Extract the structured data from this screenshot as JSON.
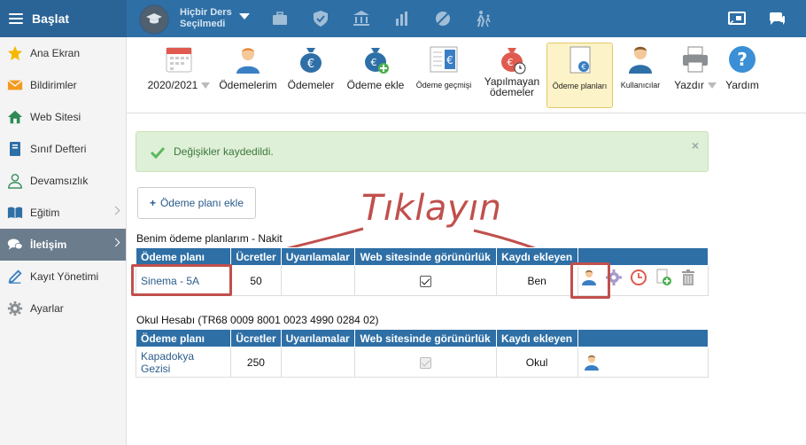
{
  "topbar": {
    "brand": "Başlat",
    "course_line1": "Hiçbir Ders",
    "course_line2": "Seçilmedi",
    "icons": [
      "briefcase-icon",
      "shield-icon",
      "bank-icon",
      "bar-chart-icon",
      "no-phone-icon",
      "walking-kids-icon",
      "cast-icon",
      "chat-icon"
    ]
  },
  "sidebar": {
    "items": [
      {
        "label": "Ana Ekran",
        "icon": "star-icon"
      },
      {
        "label": "Bildirimler",
        "icon": "envelope-icon"
      },
      {
        "label": "Web Sitesi",
        "icon": "home-icon"
      },
      {
        "label": "Sınıf Defteri",
        "icon": "notebook-icon"
      },
      {
        "label": "Devamsızlık",
        "icon": "person-outline-icon"
      },
      {
        "label": "Eğitim",
        "icon": "book-icon"
      },
      {
        "label": "İletişim",
        "icon": "chat-bubbles-icon"
      },
      {
        "label": "Kayıt Yönetimi",
        "icon": "pencil-icon"
      },
      {
        "label": "Ayarlar",
        "icon": "gear-icon"
      }
    ]
  },
  "toolbar": {
    "year": "2020/2021",
    "odemelerim": "Ödemelerim",
    "odemeler": "Ödemeler",
    "odeme_ekle": "Ödeme ekle",
    "odeme_gecmisi": "Ödeme geçmişi",
    "yapilmayan_1": "Yapılmayan",
    "yapilmayan_2": "ödemeler",
    "odeme_planlari": "Ödeme planları",
    "kullanicilar": "Kullanıcılar",
    "yazdir": "Yazdır",
    "yardim": "Yardım"
  },
  "alert": {
    "message": "Değişikler kaydedildi.",
    "close": "×"
  },
  "add_plan_button": "Ödeme planı ekle",
  "annotation": "Tıklayın",
  "section1": {
    "title": "Benim ödeme planlarım - Nakit",
    "headers": [
      "Ödeme planı",
      "Ücretler",
      "Uyarılamalar",
      "Web sitesinde görünürlük",
      "Kaydı ekleyen"
    ],
    "row": {
      "name": "Sinema - 5A",
      "fee": "50",
      "warnings": "",
      "visible": true,
      "added_by": "Ben"
    }
  },
  "section2": {
    "title": "Okul Hesabı (TR68 0009 8001 0023 4990 0284 02)",
    "headers": [
      "Ödeme planı",
      "Ücretler",
      "Uyarılamalar",
      "Web sitesinde görünürlük",
      "Kaydı ekleyen"
    ],
    "row": {
      "name": "Kapadokya Gezisi",
      "fee": "250",
      "warnings": "",
      "visible": true,
      "added_by": "Okul"
    }
  },
  "colors": {
    "header": "#2e6fa6",
    "annotation": "#c0504d",
    "alert_bg": "#dff0d8"
  }
}
